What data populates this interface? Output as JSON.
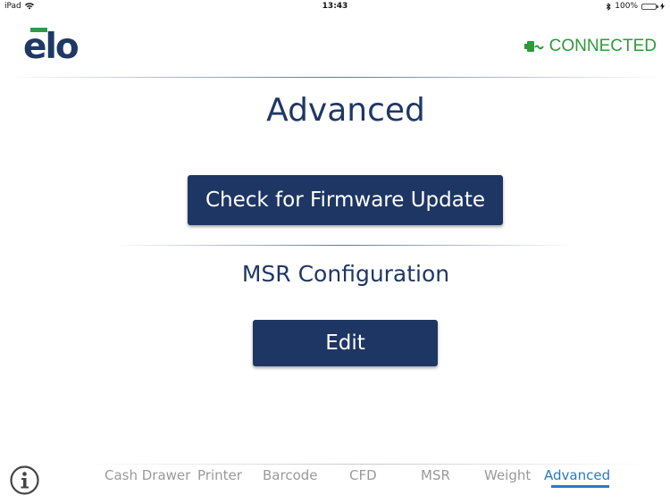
{
  "status_bar": {
    "carrier": "iPad",
    "time": "13:43",
    "battery": "100%",
    "battery_level": 1.0
  },
  "header": {
    "logo_text": "elo",
    "connection_status": "CONNECTED",
    "connection_icon": "plug-icon"
  },
  "main": {
    "title": "Advanced",
    "firmware_button_label": "Check for Firmware Update",
    "msr_section_title": "MSR Configuration",
    "edit_button_label": "Edit"
  },
  "tabs": [
    {
      "label": "Cash Drawer",
      "active": false
    },
    {
      "label": "Printer",
      "active": false
    },
    {
      "label": "Barcode",
      "active": false
    },
    {
      "label": "CFD",
      "active": false
    },
    {
      "label": "MSR",
      "active": false
    },
    {
      "label": "Weight",
      "active": false
    },
    {
      "label": "Advanced",
      "active": true
    }
  ],
  "colors": {
    "brand_navy": "#1e3663",
    "connected_green": "#2e9a3a",
    "active_tab_blue": "#2a7bc0",
    "inactive_tab_gray": "#9a9a9a"
  }
}
